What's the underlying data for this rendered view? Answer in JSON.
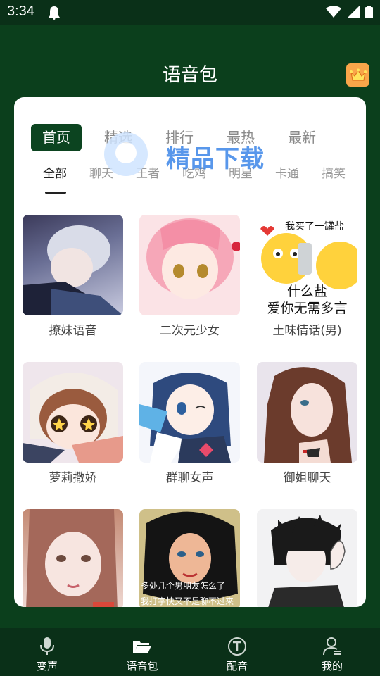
{
  "status_bar": {
    "time": "3:34"
  },
  "header": {
    "title": "语音包"
  },
  "tabs": [
    {
      "label": "首页",
      "active": true
    },
    {
      "label": "精选",
      "active": false
    },
    {
      "label": "排行",
      "active": false
    },
    {
      "label": "最热",
      "active": false
    },
    {
      "label": "最新",
      "active": false
    }
  ],
  "subtabs": [
    {
      "label": "全部",
      "active": true
    },
    {
      "label": "聊天",
      "active": false
    },
    {
      "label": "王者",
      "active": false
    },
    {
      "label": "吃鸡",
      "active": false
    },
    {
      "label": "明星",
      "active": false
    },
    {
      "label": "卡通",
      "active": false
    },
    {
      "label": "搞笑",
      "active": false
    }
  ],
  "watermark": {
    "text": "精品下载"
  },
  "packs": [
    {
      "label": "撩妹语音",
      "icon": "anime-boy-lying-avatar"
    },
    {
      "label": "二次元少女",
      "icon": "pink-hair-girl-avatar"
    },
    {
      "label": "土味情话(男)",
      "icon": "emoji-meme-avatar",
      "text_top": "我买了一罐盐",
      "text_bottom_1": "什么盐",
      "text_bottom_2": "爱你无需多言"
    },
    {
      "label": "萝莉撒娇",
      "icon": "chibi-girl-avatar"
    },
    {
      "label": "群聊女声",
      "icon": "blue-hair-girl-avatar"
    },
    {
      "label": "御姐聊天",
      "icon": "woman-portrait-avatar"
    },
    {
      "label": "",
      "icon": "girl-portrait-avatar"
    },
    {
      "label": "",
      "icon": "retro-woman-avatar",
      "text_1": "多处几个男朋友怎么了",
      "text_2": "我打字快又不是聊不过来"
    },
    {
      "label": "",
      "icon": "dark-hair-boy-avatar"
    }
  ],
  "bottom_nav": [
    {
      "label": "变声",
      "icon": "microphone-icon"
    },
    {
      "label": "语音包",
      "icon": "folder-open-icon"
    },
    {
      "label": "配音",
      "icon": "text-dubbing-icon"
    },
    {
      "label": "我的",
      "icon": "user-icon"
    }
  ]
}
